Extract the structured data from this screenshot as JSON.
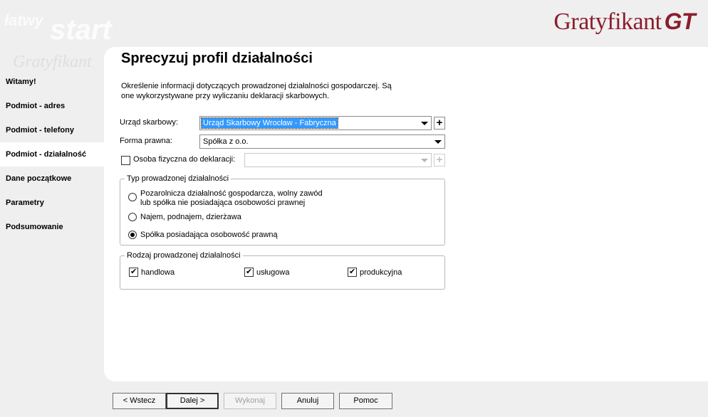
{
  "brand": {
    "art_line1": "łatwy",
    "art_line2": "start",
    "art_line3": "Gratyfikant",
    "logo_text": "Gratyfikant",
    "logo_suffix": "GT",
    "logo_color": "#8b1d2c"
  },
  "sidebar": {
    "items": [
      {
        "label": "Witamy!"
      },
      {
        "label": "Podmiot - adres"
      },
      {
        "label": "Podmiot - telefony"
      },
      {
        "label": "Podmiot - działalność",
        "active": true
      },
      {
        "label": "Dane początkowe"
      },
      {
        "label": "Parametry"
      },
      {
        "label": "Podsumowanie"
      }
    ]
  },
  "page": {
    "title": "Sprecyzuj profil działalności",
    "description": "Określenie informacji dotyczących prowadzonej działalności gospodarczej. Są one wykorzystywane przy wyliczaniu deklaracji skarbowych."
  },
  "form": {
    "urzad_label": "Urząd skarbowy:",
    "urzad_value": "Urząd Skarbowy Wrocław - Fabryczna",
    "forma_label": "Forma prawna:",
    "forma_value": "Spółka z o.o.",
    "osoba_label": "Osoba fizyczna do deklaracji:",
    "osoba_checked": false,
    "osoba_value": ""
  },
  "typ_group": {
    "legend": "Typ prowadzonej działalności",
    "options": [
      {
        "label_line1": "Pozarolnicza działalność gospodarcza, wolny zawód",
        "label_line2": "lub spółka nie posiadająca osobowości prawnej",
        "selected": false
      },
      {
        "label_line1": "Najem, podnajem, dzierżawa",
        "selected": false
      },
      {
        "label_line1": "Spółka posiadająca osobowość prawną",
        "selected": true
      }
    ]
  },
  "rodzaj_group": {
    "legend": "Rodzaj prowadzonej działalności",
    "options": [
      {
        "label": "handlowa",
        "checked": true
      },
      {
        "label": "usługowa",
        "checked": true
      },
      {
        "label": "produkcyjna",
        "checked": true
      }
    ]
  },
  "buttons": {
    "back": "< Wstecz",
    "next": "Dalej >",
    "execute": "Wykonaj",
    "cancel": "Anuluj",
    "help": "Pomoc"
  }
}
